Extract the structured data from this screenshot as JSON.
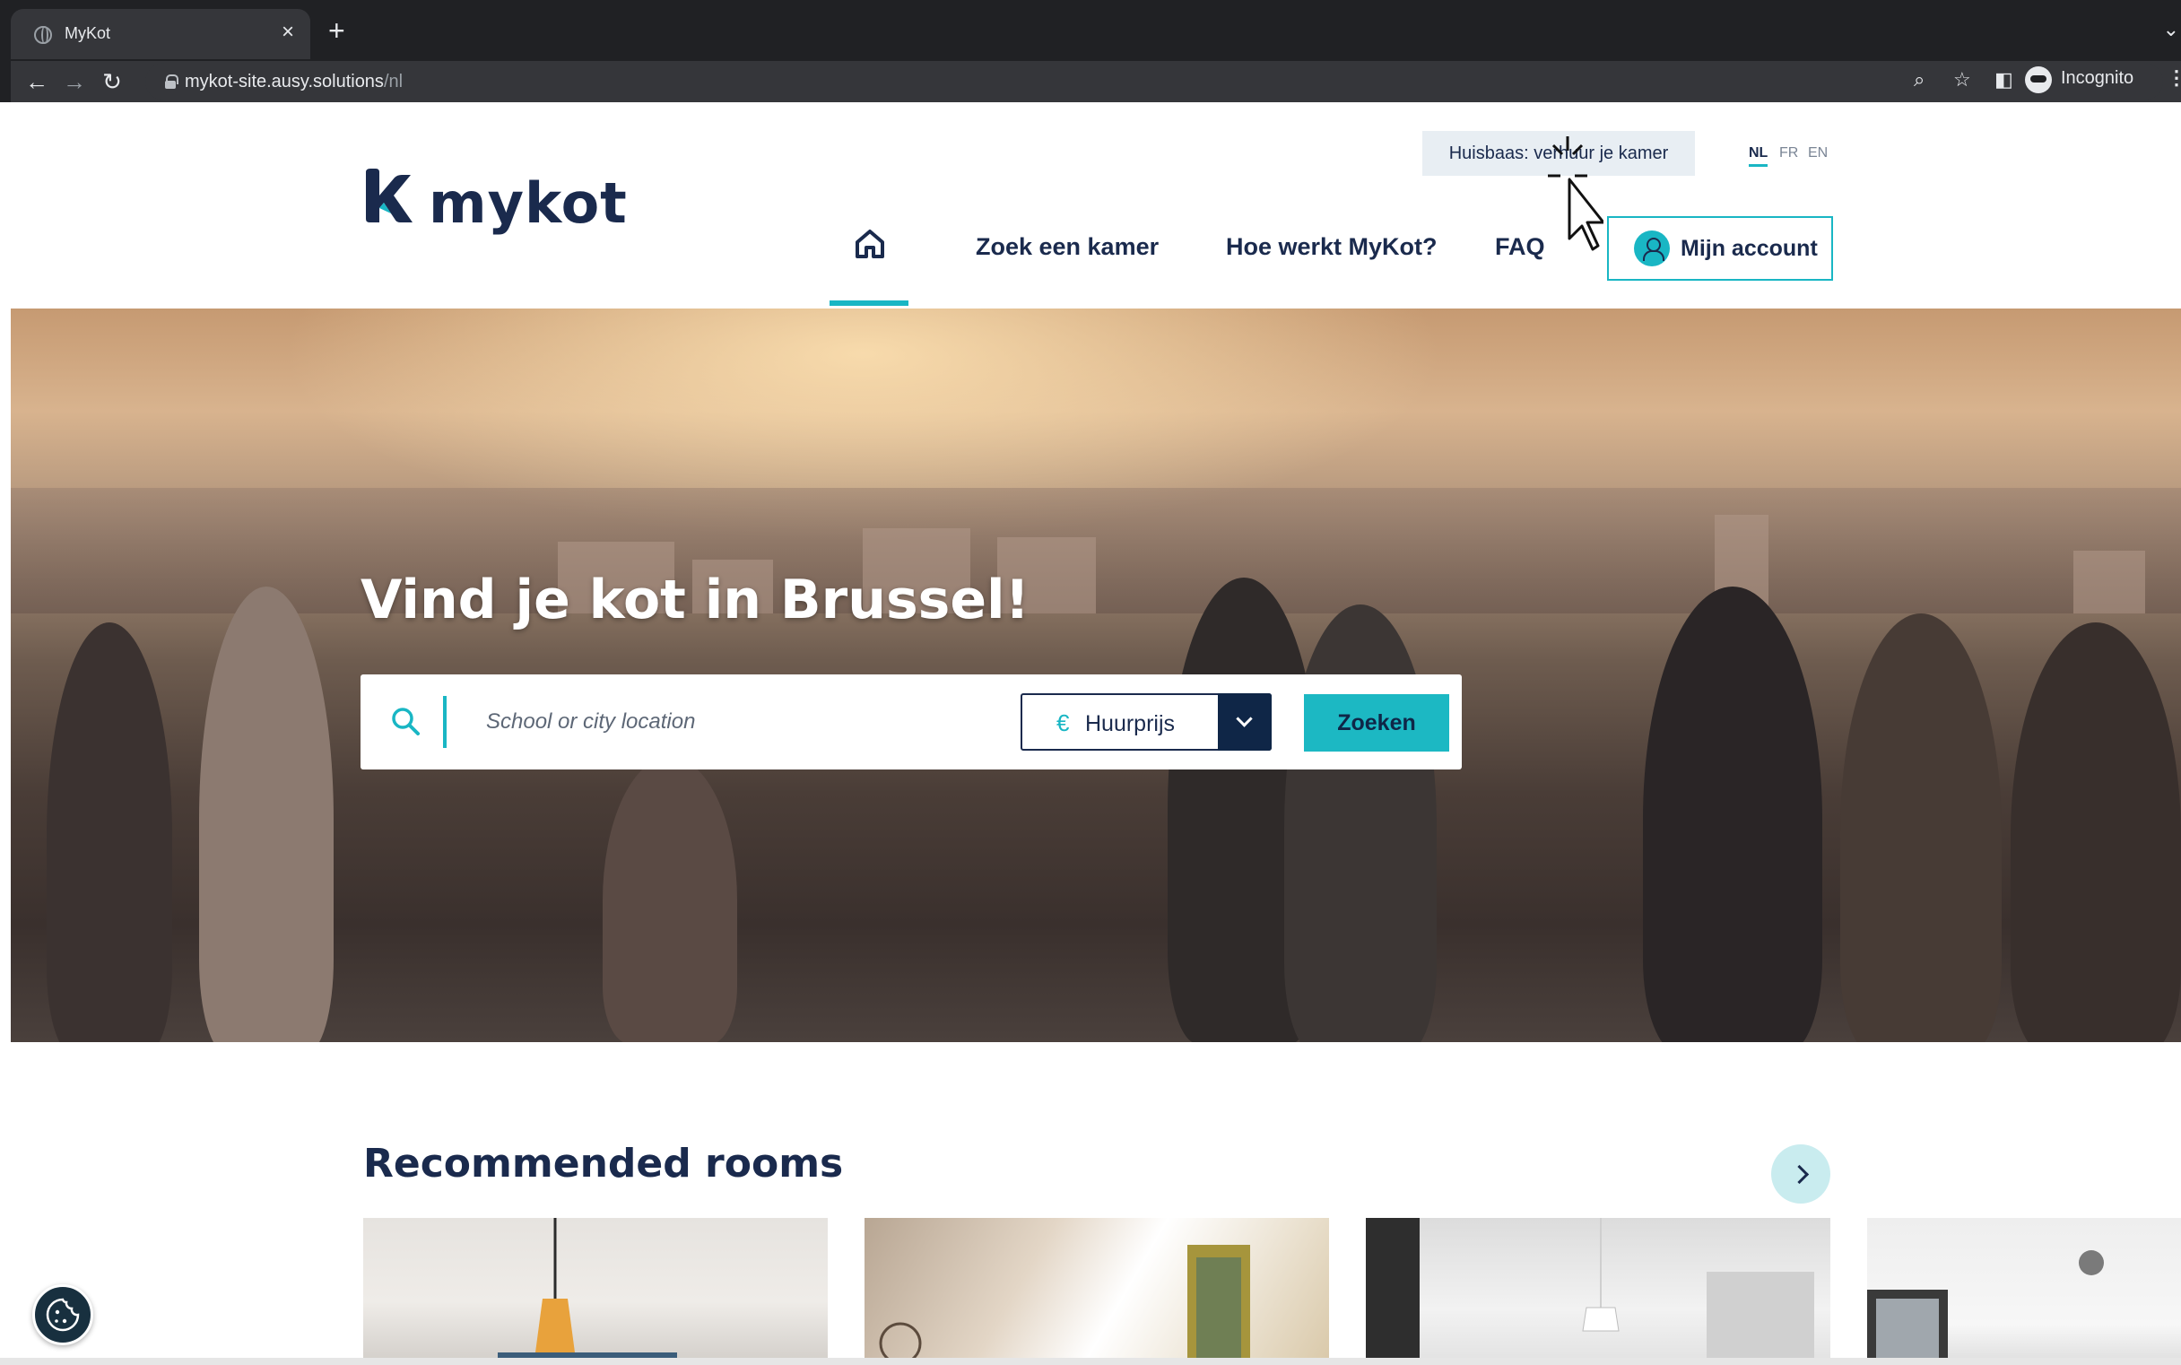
{
  "browser": {
    "tab_title": "MyKot",
    "tab_close": "×",
    "new_tab": "+",
    "url_main": "mykot-site.ausy.solutions",
    "url_path": "/nl",
    "profile_label": "Incognito"
  },
  "header": {
    "logo_text": "mykot",
    "landlord_button": "Huisbaas: verhuur je kamer",
    "languages": [
      "NL",
      "FR",
      "EN"
    ],
    "active_language": "NL",
    "nav": {
      "search_room": "Zoek een kamer",
      "how_it_works": "Hoe werkt MyKot?",
      "faq": "FAQ"
    },
    "account_button": "Mijn account"
  },
  "hero": {
    "title": "Vind je kot in Brussel!",
    "search_placeholder": "School or city location",
    "price_currency": "€",
    "price_label": "Huurprijs",
    "search_button": "Zoeken"
  },
  "recommended": {
    "title": "Recommended rooms"
  },
  "colors": {
    "brand_navy": "#1a2a4d",
    "brand_teal": "#19b6c4"
  }
}
